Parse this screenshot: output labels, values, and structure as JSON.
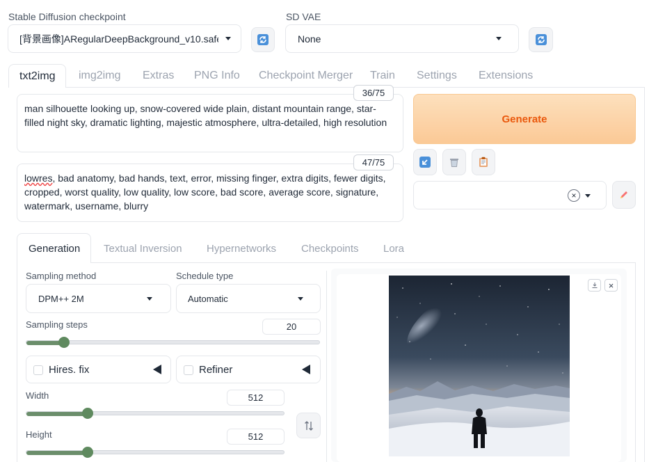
{
  "top": {
    "checkpoint_label": "Stable Diffusion checkpoint",
    "checkpoint_value": "[背景画像]ARegularDeepBackground_v10.safet",
    "vae_label": "SD VAE",
    "vae_value": "None"
  },
  "main_tabs": [
    "txt2img",
    "img2img",
    "Extras",
    "PNG Info",
    "Checkpoint Merger",
    "Train",
    "Settings",
    "Extensions"
  ],
  "prompt": {
    "text": "man silhouette looking up, snow-covered wide plain, distant mountain range, star-filled night sky, dramatic lighting, majestic atmosphere, ultra-detailed, high resolution",
    "counter": "36/75"
  },
  "negative_prompt": {
    "text": "lowres, bad anatomy, bad hands, text, error, missing finger, extra digits, fewer digits, cropped, worst quality, low quality, low score, bad score, average score, signature, watermark, username, blurry",
    "counter": "47/75"
  },
  "generate_label": "Generate",
  "sub_tabs": [
    "Generation",
    "Textual Inversion",
    "Hypernetworks",
    "Checkpoints",
    "Lora"
  ],
  "generation": {
    "sampling_method_label": "Sampling method",
    "sampling_method_value": "DPM++ 2M",
    "schedule_type_label": "Schedule type",
    "schedule_type_value": "Automatic",
    "sampling_steps_label": "Sampling steps",
    "sampling_steps_value": "20",
    "sampling_steps_fraction": 0.13,
    "hires_fix_label": "Hires. fix",
    "refiner_label": "Refiner",
    "width_label": "Width",
    "width_value": "512",
    "width_fraction": 0.24,
    "height_label": "Height",
    "height_value": "512",
    "height_fraction": 0.24
  },
  "colors": {
    "generate_bg": "#fcd7ad",
    "generate_text": "#ea580c",
    "slider": "#5f8a5f"
  }
}
